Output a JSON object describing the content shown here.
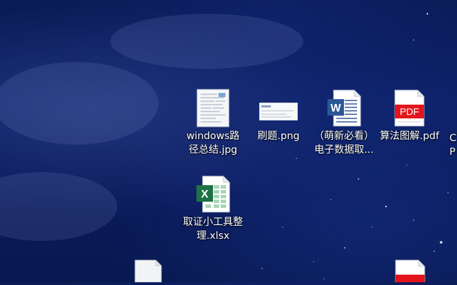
{
  "desktop": {
    "icons": [
      {
        "label": "windows路\n径总结.jpg",
        "type": "image-thumbnail-icon"
      },
      {
        "label": "刷题.png",
        "type": "image-thumbnail-icon"
      },
      {
        "label": "（萌新必看）\n电子数据取...",
        "type": "word-document-icon"
      },
      {
        "label": "算法图解.pdf",
        "type": "pdf-icon"
      },
      {
        "label": "取证小工具整\n理.xlsx",
        "type": "excel-spreadsheet-icon"
      }
    ],
    "partial": {
      "right_edge_text": "C\nP"
    },
    "icon_badges": {
      "word_letter": "W",
      "excel_letter": "X",
      "pdf_text": "PDF"
    },
    "colors": {
      "background": "#0d2168",
      "word_blue": "#2b5797",
      "excel_green": "#1e7145",
      "pdf_red": "#e3141b"
    }
  }
}
